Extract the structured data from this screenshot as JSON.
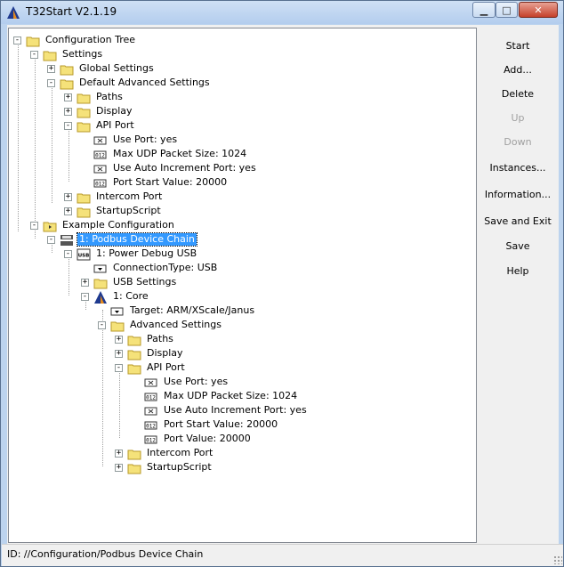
{
  "window": {
    "title": "T32Start V2.1.19"
  },
  "tree": [
    {
      "label": "Configuration Tree",
      "icon": "folder-icon",
      "exp": "-"
    },
    {
      "label": "Settings",
      "icon": "folder-icon",
      "exp": "-"
    },
    {
      "label": "Global Settings",
      "icon": "folder-icon",
      "exp": "+"
    },
    {
      "label": "Default Advanced Settings",
      "icon": "folder-icon",
      "exp": "-"
    },
    {
      "label": "Paths",
      "icon": "folder-icon",
      "exp": "+"
    },
    {
      "label": "Display",
      "icon": "folder-icon",
      "exp": "+"
    },
    {
      "label": "API Port",
      "icon": "folder-icon",
      "exp": "-"
    },
    {
      "label": "Use Port: yes",
      "icon": "checkbox-icon",
      "exp": ""
    },
    {
      "label": "Max UDP Packet Size: 1024",
      "icon": "number-icon",
      "exp": ""
    },
    {
      "label": "Use Auto Increment Port: yes",
      "icon": "checkbox-icon",
      "exp": ""
    },
    {
      "label": "Port Start Value: 20000",
      "icon": "number-icon",
      "exp": ""
    },
    {
      "label": "Intercom Port",
      "icon": "folder-icon",
      "exp": "+"
    },
    {
      "label": "StartupScript",
      "icon": "folder-icon",
      "exp": "+"
    },
    {
      "label": "Example Configuration",
      "icon": "config-folder-icon",
      "exp": "-"
    },
    {
      "label": "1: Podbus Device Chain",
      "icon": "device-chain-icon",
      "exp": "-",
      "selected": true
    },
    {
      "label": "1: Power Debug USB",
      "icon": "usb-icon",
      "exp": "-"
    },
    {
      "label": "ConnectionType: USB",
      "icon": "dropdown-icon",
      "exp": ""
    },
    {
      "label": "USB Settings",
      "icon": "folder-icon",
      "exp": "+"
    },
    {
      "label": "1: Core",
      "icon": "core-icon",
      "exp": "-"
    },
    {
      "label": "Target: ARM/XScale/Janus",
      "icon": "dropdown-icon",
      "exp": ""
    },
    {
      "label": "Advanced Settings",
      "icon": "folder-icon",
      "exp": "-"
    },
    {
      "label": "Paths",
      "icon": "folder-icon",
      "exp": "+"
    },
    {
      "label": "Display",
      "icon": "folder-icon",
      "exp": "+"
    },
    {
      "label": "API Port",
      "icon": "folder-icon",
      "exp": "-"
    },
    {
      "label": "Use Port: yes",
      "icon": "checkbox-icon",
      "exp": ""
    },
    {
      "label": "Max UDP Packet Size: 1024",
      "icon": "number-icon",
      "exp": ""
    },
    {
      "label": "Use Auto Increment Port: yes",
      "icon": "checkbox-icon",
      "exp": ""
    },
    {
      "label": "Port Start Value: 20000",
      "icon": "number-icon",
      "exp": ""
    },
    {
      "label": "Port Value: 20000",
      "icon": "number-icon",
      "exp": ""
    },
    {
      "label": "Intercom Port",
      "icon": "folder-icon",
      "exp": "+"
    },
    {
      "label": "StartupScript",
      "icon": "folder-icon",
      "exp": "+"
    }
  ],
  "buttons": [
    {
      "label": "Start",
      "enabled": true
    },
    {
      "label": "Add...",
      "enabled": true
    },
    {
      "label": "Delete",
      "enabled": true
    },
    {
      "label": "Up",
      "enabled": false
    },
    {
      "label": "Down",
      "enabled": false
    },
    {
      "label": "Instances...",
      "enabled": true
    },
    {
      "label": "Information...",
      "enabled": true
    },
    {
      "label": "Save and Exit",
      "enabled": true
    },
    {
      "label": "Save",
      "enabled": true
    },
    {
      "label": "Help",
      "enabled": true
    }
  ],
  "status": {
    "text": "ID: //Configuration/Podbus Device Chain"
  },
  "colors": {
    "selection": "#3399ff",
    "folder": "#f5e27a",
    "accent_core": "#1f3a8f"
  }
}
